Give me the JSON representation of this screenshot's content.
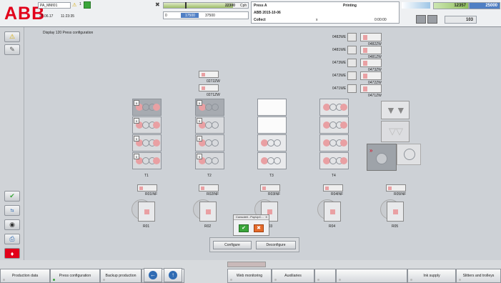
{
  "header": {
    "logo": "ABB",
    "user": "PA_MMI01",
    "user_count": "1",
    "date": "27.06.17",
    "time": "11:23:35",
    "speed_value": "22300",
    "speed_unit": "Cph",
    "scale_min": "0",
    "scale_set": "17500",
    "scale_max": "37500",
    "press_name": "Press A",
    "press_sub": "ABB 2015-10-06",
    "status_label": "Collect",
    "status_x": "x",
    "mode": "Printing",
    "run_time": "0:00:00",
    "counter_value": "12357",
    "counter_target": "25000",
    "waste_value": "103",
    "counter_progress": 0.49
  },
  "left_buttons": [
    "warning-button",
    "pen-button",
    "check-button",
    "swap-button",
    "camera-button",
    "print-button",
    "flag-button"
  ],
  "main": {
    "title": "Display 120 Press configuration",
    "right_units": [
      {
        "label": "0482WE",
        "code": "0482ZW"
      },
      {
        "label": "0481WE",
        "code": "0481ZW"
      },
      {
        "label": "0473WE",
        "code": "0473ZW"
      },
      {
        "label": "0472WE",
        "code": "0472ZW"
      },
      {
        "label": "0471WE",
        "code": "0471ZW"
      }
    ],
    "upper_units": [
      "0272ZW",
      "0271ZW"
    ],
    "towers": [
      "T1",
      "T2",
      "T3",
      "T4"
    ],
    "reels": [
      {
        "name": "R01",
        "inf": "R01INF"
      },
      {
        "name": "R02",
        "inf": "R02INF"
      },
      {
        "name": "R03",
        "inf": "R03INF"
      },
      {
        "name": "R04",
        "inf": "R04INF"
      },
      {
        "name": "R05",
        "inf": "R05INF"
      }
    ],
    "popup": {
      "title": "Consoleit - PopUpC...",
      "close": "X"
    },
    "configure": "Configure",
    "deconfigure": "Deconfigure"
  },
  "bottom_nav": [
    {
      "label": "Production data",
      "green": false
    },
    {
      "label": "Press configuration",
      "green": true
    },
    {
      "label": "Backup production",
      "green": false
    },
    {
      "label": "",
      "green": false
    },
    {
      "label": "Web monitoring",
      "green": false
    },
    {
      "label": "Auxiliaries",
      "green": false
    },
    {
      "label": "",
      "green": false
    },
    {
      "label": "",
      "green": false
    },
    {
      "label": "Ink supply",
      "green": false
    },
    {
      "label": "Slitters and trolleys",
      "green": false
    }
  ],
  "colors": {
    "accent_red": "#e2001a",
    "pink": "#e9a0a3",
    "green_ok": "#3aa53a",
    "blue_bar": "#4f7fc4"
  }
}
